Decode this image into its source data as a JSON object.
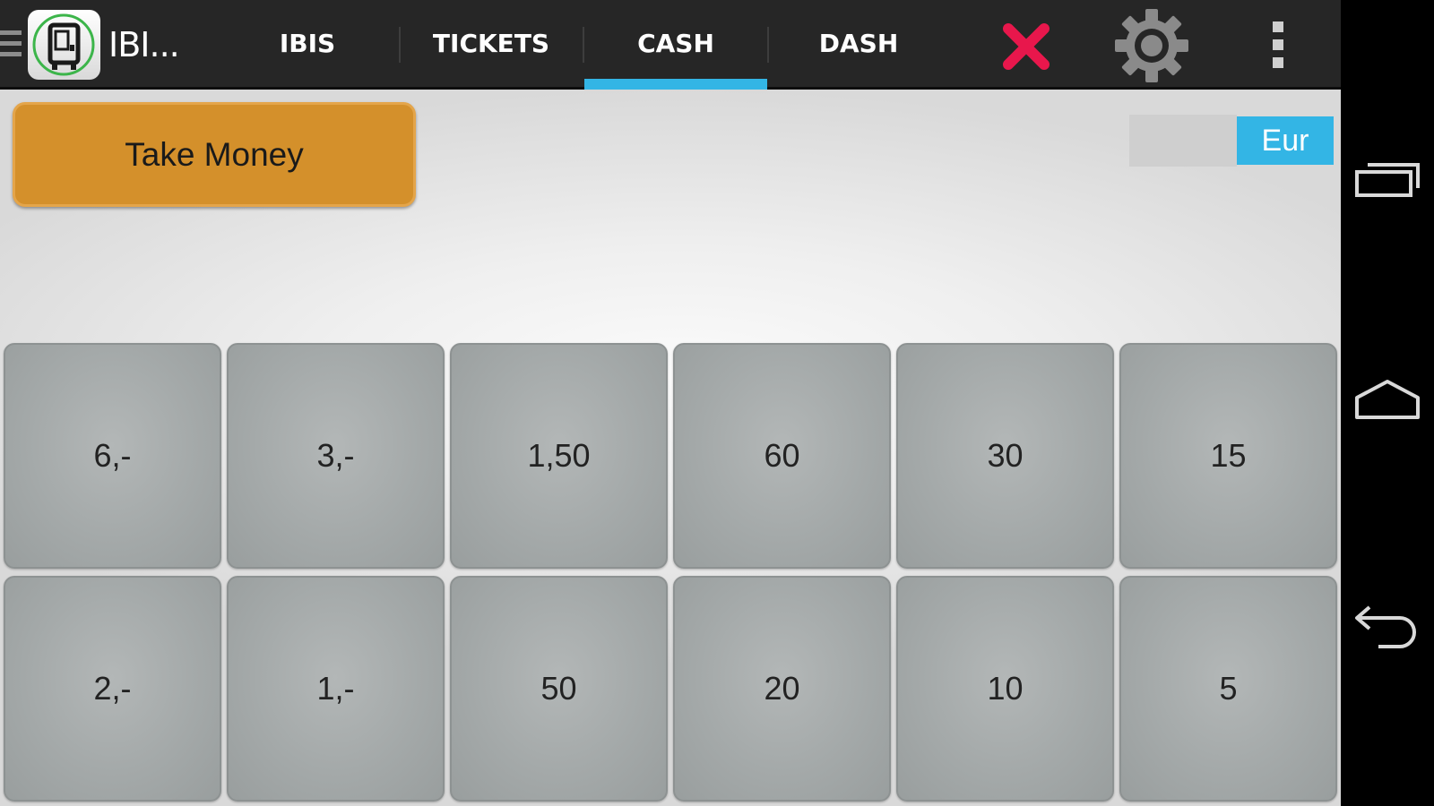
{
  "app": {
    "title": "IBI...",
    "tabs": [
      {
        "label": "IBIS",
        "selected": false
      },
      {
        "label": "TICKETS",
        "selected": false
      },
      {
        "label": "CASH",
        "selected": true
      },
      {
        "label": "DASH",
        "selected": false
      }
    ],
    "accent_color": "#33b5e5",
    "close_color": "#e8174c"
  },
  "actions": {
    "take_money": "Take Money",
    "take_money_color": "#d4902b"
  },
  "currency": {
    "selected": "Eur"
  },
  "coins": {
    "row1": [
      "6,-",
      "3,-",
      "1,50",
      "60",
      "30",
      "15"
    ],
    "row2": [
      "2,-",
      "1,-",
      "50",
      "20",
      "10",
      "5"
    ]
  },
  "icons": {
    "drawer": "hamburger-icon",
    "app": "bus-ticket-machine-icon",
    "close": "close-icon",
    "settings": "gear-icon",
    "overflow": "overflow-menu-icon",
    "recents": "recent-apps-icon",
    "home": "home-icon",
    "back": "back-icon"
  }
}
